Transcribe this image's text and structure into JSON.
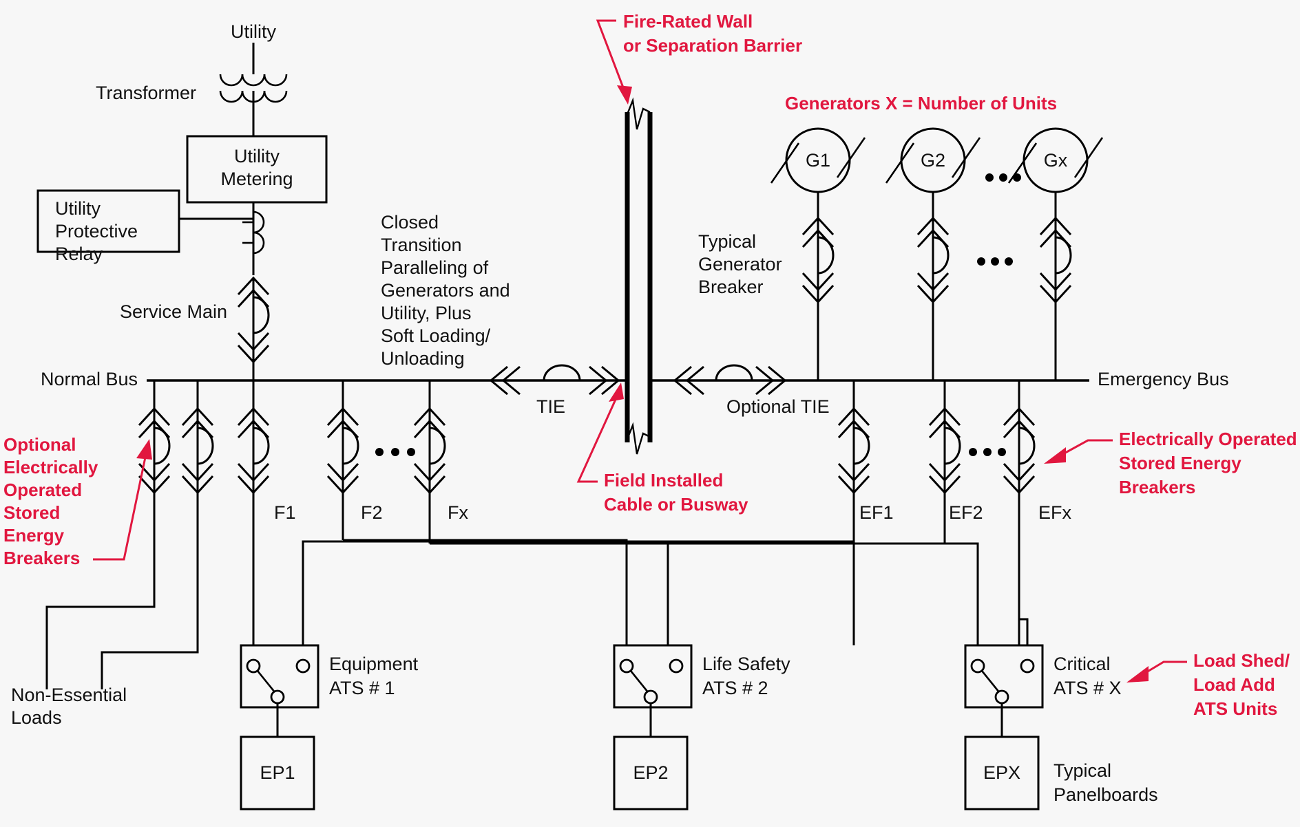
{
  "diagram": {
    "title": "Emergency Power System One-Line Diagram",
    "colors": {
      "annotation_red": "#e1173f",
      "line_black": "#000000",
      "background": "#f7f7f7"
    },
    "utility_section": {
      "utility_label": "Utility",
      "transformer_label": "Transformer",
      "utility_metering_label_line1": "Utility",
      "utility_metering_label_line2": "Metering",
      "utility_relay_label_line1": "Utility",
      "utility_relay_label_line2": "Protective",
      "utility_relay_label_line3": "Relay",
      "service_main_label": "Service Main"
    },
    "buses": {
      "normal_bus_label": "Normal Bus",
      "emergency_bus_label": "Emergency Bus"
    },
    "tie_section": {
      "closed_transition_note": [
        "Closed",
        "Transition",
        "Paralleling of",
        "Generators and",
        "Utility, Plus",
        "Soft Loading/",
        "Unloading"
      ],
      "tie_label": "TIE",
      "optional_tie_label": "Optional TIE"
    },
    "firewall": {
      "callout_line1": "Fire-Rated Wall",
      "callout_line2": "or Separation Barrier",
      "field_installed_line1": "Field Installed",
      "field_installed_line2": "Cable or Busway"
    },
    "generators": {
      "callout": "Generators  X = Number of Units",
      "typical_breaker_label_line1": "Typical",
      "typical_breaker_label_line2": "Generator",
      "typical_breaker_label_line3": "Breaker",
      "units": [
        "G1",
        "G2",
        "Gx"
      ],
      "ellipsis": "..."
    },
    "normal_feeders": {
      "labels": [
        "F1",
        "F2",
        "Fx"
      ],
      "non_essential_label_line1": "Non-Essential",
      "non_essential_label_line2": "Loads",
      "optional_breaker_callout": [
        "Optional",
        "Electrically",
        "Operated",
        "Stored",
        "Energy",
        "Breakers"
      ]
    },
    "emergency_feeders": {
      "labels": [
        "EF1",
        "EF2",
        "EFx"
      ],
      "breaker_callout": [
        "Electrically Operated",
        "Stored Energy",
        "Breakers"
      ]
    },
    "ats_units": [
      {
        "name_line1": "Equipment",
        "name_line2": "ATS # 1",
        "panel": "EP1"
      },
      {
        "name_line1": "Life Safety",
        "name_line2": "ATS # 2",
        "panel": "EP2"
      },
      {
        "name_line1": "Critical",
        "name_line2": "ATS # X",
        "panel": "EPX"
      }
    ],
    "ats_callout": [
      "Load Shed/",
      "Load Add",
      "ATS Units"
    ],
    "panelboard_label_line1": "Typical",
    "panelboard_label_line2": "Panelboards"
  }
}
